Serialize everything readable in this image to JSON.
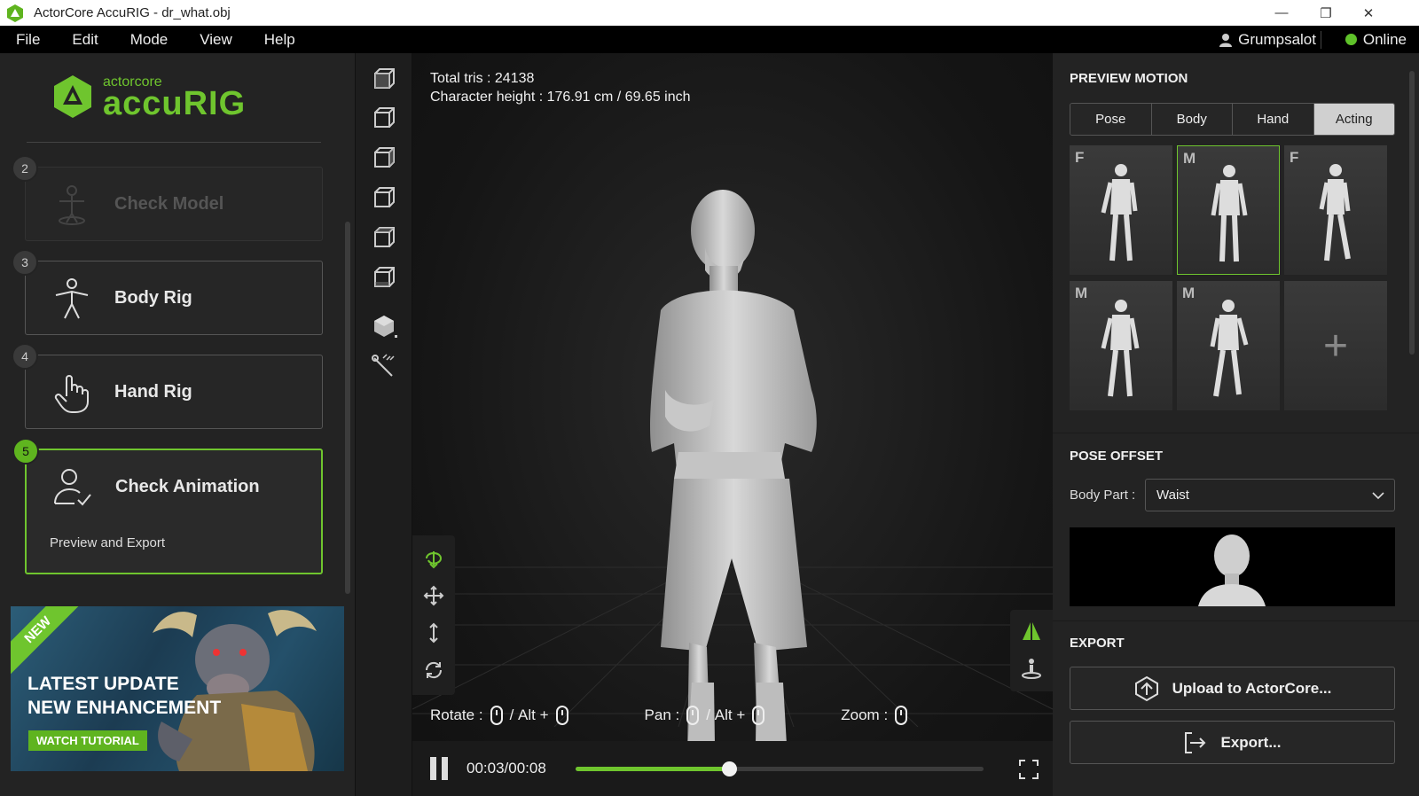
{
  "window": {
    "title": "ActorCore AccuRIG - dr_what.obj"
  },
  "menu": {
    "items": [
      "File",
      "Edit",
      "Mode",
      "View",
      "Help"
    ],
    "user": "Grumpsalot",
    "status": "Online"
  },
  "logo": {
    "small": "actorcore",
    "big": "accuRIG"
  },
  "steps": [
    {
      "num": "2",
      "label": "Check Model",
      "state": "disabled",
      "icon": "person-check-icon"
    },
    {
      "num": "3",
      "label": "Body Rig",
      "state": "normal",
      "icon": "body-rig-icon"
    },
    {
      "num": "4",
      "label": "Hand Rig",
      "state": "normal",
      "icon": "hand-icon"
    },
    {
      "num": "5",
      "label": "Check Animation",
      "sub": "Preview and Export",
      "state": "active",
      "icon": "user-check-icon"
    }
  ],
  "banner": {
    "badge": "NEW",
    "line1": "LATEST UPDATE",
    "line2": "NEW ENHANCEMENT",
    "cta": "WATCH TUTORIAL"
  },
  "viewport": {
    "total_tris": "Total tris : 24138",
    "char_height": "Character height : 176.91 cm / 69.65 inch",
    "hints": {
      "rotate": "Rotate",
      "pan": "Pan",
      "zoom": "Zoom",
      "alt": "Alt",
      "plus": "+",
      "colon": ":",
      "slash": "/"
    },
    "time": "00:03/00:08",
    "progress": 0.375
  },
  "preview_motion": {
    "title": "PREVIEW MOTION",
    "tabs": [
      "Pose",
      "Body",
      "Hand",
      "Acting"
    ],
    "active_tab": "Acting",
    "thumbs": [
      "F",
      "M",
      "F",
      "M",
      "M"
    ],
    "selected_index": 1,
    "add_label": "+"
  },
  "pose_offset": {
    "title": "POSE OFFSET",
    "body_part_label": "Body Part :",
    "body_part_value": "Waist"
  },
  "export": {
    "title": "EXPORT",
    "upload": "Upload to ActorCore...",
    "export": "Export..."
  },
  "colors": {
    "accent": "#6fc52e",
    "bg": "#232323"
  }
}
